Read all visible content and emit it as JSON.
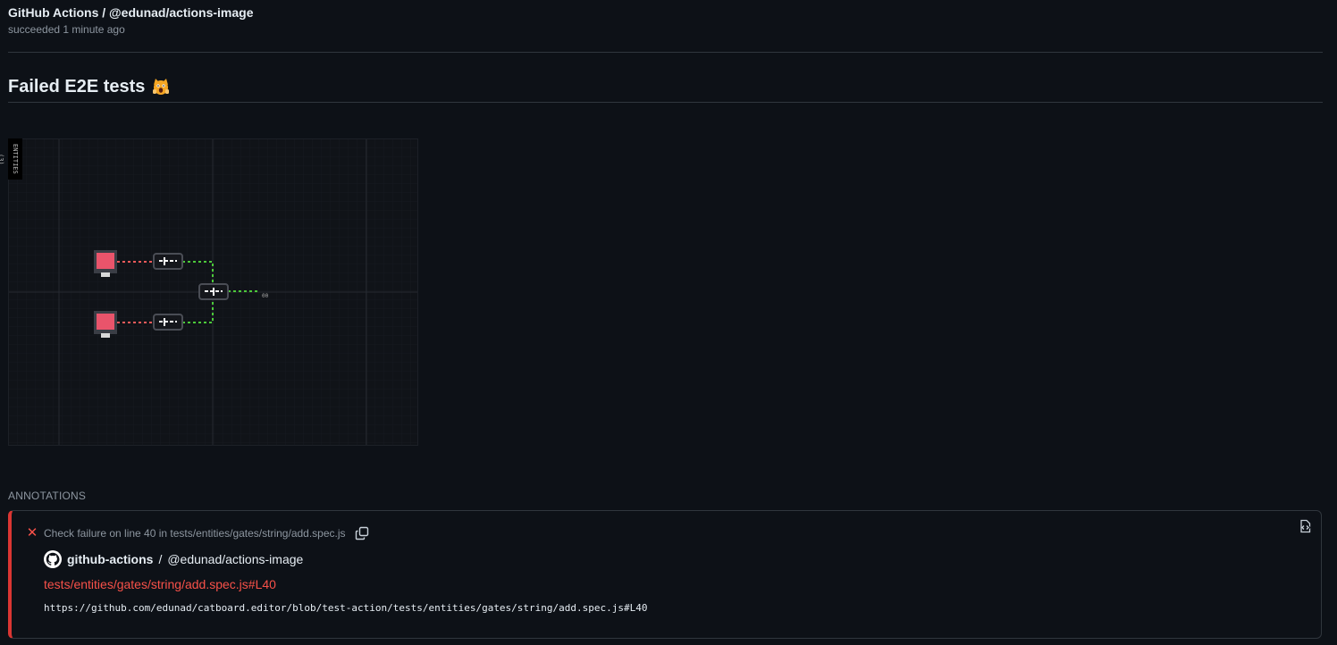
{
  "header": {
    "title": "GitHub Actions / @edunad/actions-image",
    "status": "succeeded 1 minute ago"
  },
  "section": {
    "title": "Failed E2E tests",
    "icon": "screaming-cat-icon"
  },
  "canvas": {
    "tag": "ENTITIES (3)",
    "output_label": "00"
  },
  "annotations": {
    "label": "ANNOTATIONS",
    "items": [
      {
        "level": "failure",
        "message": "Check failure on line 40 in tests/entities/gates/string/add.spec.js",
        "author": "github-actions",
        "separator": "/",
        "repo": "@edunad/actions-image",
        "path": "tests/entities/gates/string/add.spec.js#L40",
        "url": "https://github.com/edunad/catboard.editor/blob/test-action/tests/entities/gates/string/add.spec.js#L40"
      }
    ]
  },
  "colors": {
    "background": "#0d1117",
    "failure": "#f85149",
    "muted": "#8d96a0",
    "border": "#30363d"
  }
}
